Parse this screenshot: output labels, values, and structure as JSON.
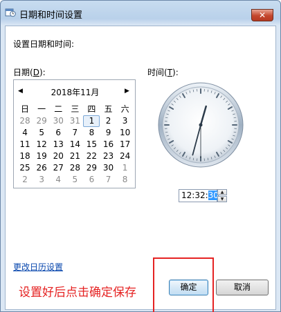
{
  "window": {
    "title": "日期和时间设置",
    "close_label": "✕"
  },
  "heading": "设置日期和时间:",
  "date_label": {
    "text": "日期(",
    "accel": "D",
    "suffix": "):"
  },
  "time_label": {
    "text": "时间(",
    "accel": "T",
    "suffix": "):"
  },
  "calendar": {
    "prev_label": "◀",
    "next_label": "▶",
    "month_title": "2018年11月",
    "weekdays": [
      "日",
      "一",
      "二",
      "三",
      "四",
      "五",
      "六"
    ],
    "weeks": [
      [
        "28",
        "29",
        "30",
        "31",
        "1",
        "2",
        "3"
      ],
      [
        "4",
        "5",
        "6",
        "7",
        "8",
        "9",
        "10"
      ],
      [
        "11",
        "12",
        "13",
        "14",
        "15",
        "16",
        "17"
      ],
      [
        "18",
        "19",
        "20",
        "21",
        "22",
        "23",
        "24"
      ],
      [
        "25",
        "26",
        "27",
        "28",
        "29",
        "30",
        "1"
      ],
      [
        "2",
        "3",
        "4",
        "5",
        "6",
        "7",
        "8"
      ]
    ],
    "selected_day": "1"
  },
  "time": {
    "hours": "12",
    "minutes": "32",
    "seconds": "30",
    "separator": ":"
  },
  "change_calendar_link": "更改日历设置",
  "annotation_text": "设置好后点击确定保存",
  "ok_button": "确定",
  "cancel_button": "取消",
  "accent_color": "#e52222"
}
